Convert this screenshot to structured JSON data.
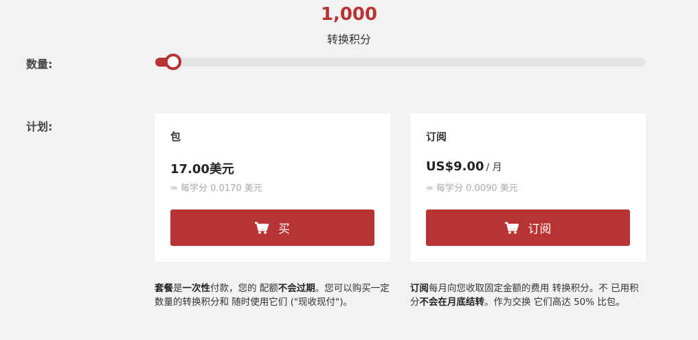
{
  "credits": {
    "amount": "1,000",
    "unit_label": "转换积分"
  },
  "quantity": {
    "label": "数量:",
    "slider_fraction": 0.0
  },
  "plans": {
    "label": "计划:",
    "items": [
      {
        "title": "包",
        "price": "17.00美元",
        "period": "",
        "per_credit": "= 每学分 0.0170 美元",
        "button_label": "买",
        "button_icon": "cart-icon"
      },
      {
        "title": "订阅",
        "price": "US$9.00",
        "period": "/ 月",
        "per_credit": "= 每学分 0.0090 美元",
        "button_label": "订阅",
        "button_icon": "cart-icon"
      }
    ]
  },
  "descriptions": {
    "package": {
      "p1_bold": "套餐",
      "p2": "是",
      "p3_bold": "一次性",
      "p4": "付款，您的 配额",
      "p5_bold": "不会过期",
      "p6": "。您可以购买一定数量的转换积分和 随时使用它们 (\"现收现付\")。"
    },
    "subscription": {
      "p1_bold": "订阅",
      "p2": "每月向您收取固定金额的费用 转换积分。不 已用积分",
      "p3_bold": "不会在月底结转",
      "p4": "。作为交换 它们高达 50% 比包。"
    }
  },
  "colors": {
    "accent": "#b83434",
    "background": "#f2f2f2",
    "card": "#ffffff",
    "muted_text": "#a8a8a8"
  }
}
